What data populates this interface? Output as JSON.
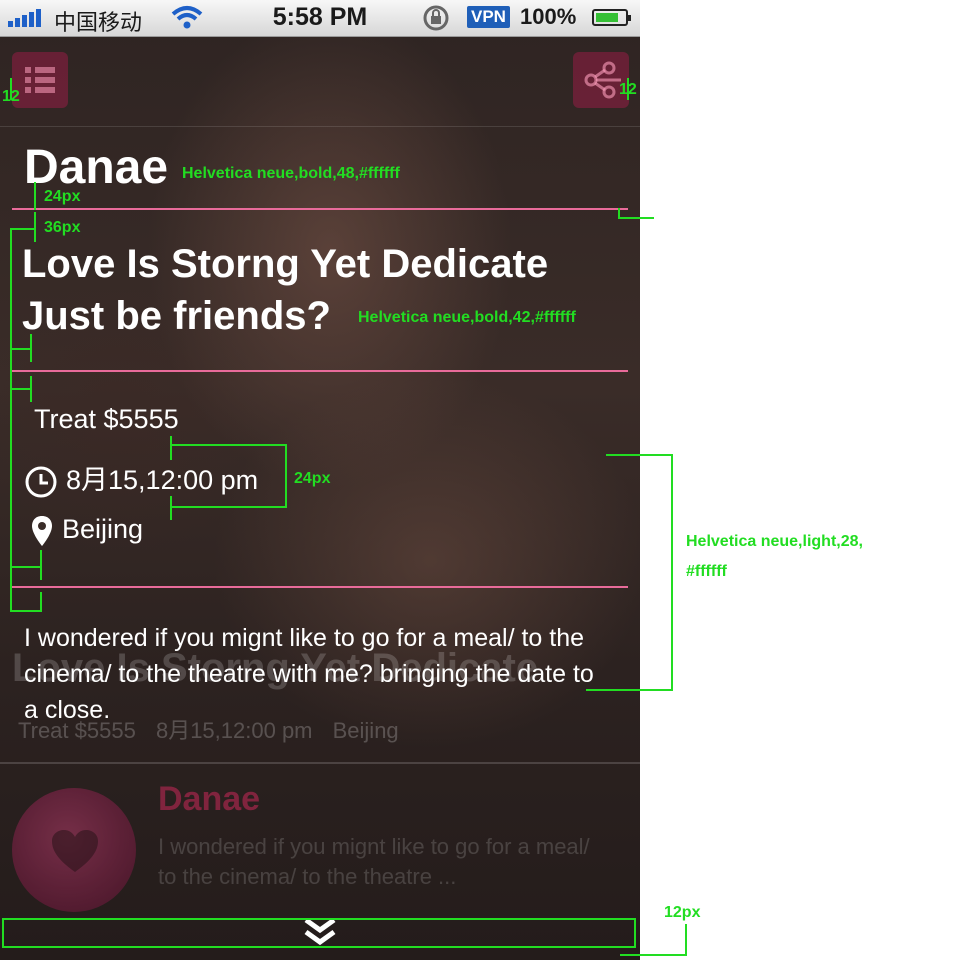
{
  "status_bar": {
    "carrier": "中国移动",
    "time": "5:58 PM",
    "vpn": "VPN",
    "battery": "100%"
  },
  "header": {
    "menu_icon": "list-icon",
    "share_icon": "share-network-icon"
  },
  "card": {
    "name": "Danae",
    "headline_line1": "Love Is Storng Yet Dedicate",
    "headline_line2": "Just be friends?",
    "treat": "Treat $5555",
    "datetime": "8月15,12:00 pm",
    "location": "Beijing",
    "message": "I wondered if you mignt like to go for a meal/ to the cinema/ to the theatre with me? bringing the date to a close."
  },
  "next_card": {
    "title": "Love Is Storng Yet Dedicate",
    "treat": "Treat $5555",
    "datetime": "8月15,12:00 pm",
    "location": "Beijing",
    "name": "Danae",
    "message_line1": "I wondered if you mignt like to go for a meal/",
    "message_line2": "to the  cinema/ to the theatre ..."
  },
  "annotations": {
    "margin_left": "12",
    "margin_right": "12",
    "name_spec": "Helvetica neue,bold,48,#ffffff",
    "gap_24": "24px",
    "gap_36": "36px",
    "headline_spec": "Helvetica neue,bold,42,#ffffff",
    "info_gap": "24px",
    "body_spec_line1": "Helvetica neue,light,28,",
    "body_spec_line2": "#ffffff",
    "bottom_gap": "12px"
  },
  "colors": {
    "accent_pink": "#e86b9a",
    "annotation_green": "#22dd22"
  }
}
